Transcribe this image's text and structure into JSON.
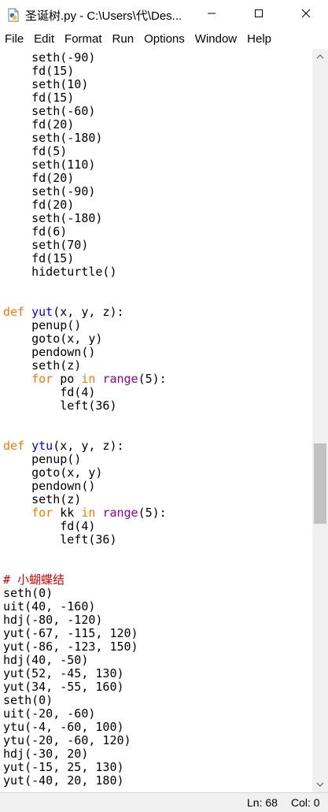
{
  "window": {
    "title": "圣诞树.py - C:\\Users\\代\\Des...",
    "icons": {
      "app": "python-file-icon",
      "minimize": "minimize-icon",
      "maximize": "maximize-icon",
      "close": "close-icon"
    }
  },
  "menu": [
    "File",
    "Edit",
    "Format",
    "Run",
    "Options",
    "Window",
    "Help"
  ],
  "editor": {
    "lines": [
      "    seth(-90)",
      "    fd(15)",
      "    seth(10)",
      "    fd(15)",
      "    seth(-60)",
      "    fd(20)",
      "    seth(-180)",
      "    fd(5)",
      "    seth(110)",
      "    fd(20)",
      "    seth(-90)",
      "    fd(20)",
      "    seth(-180)",
      "    fd(6)",
      "    seth(70)",
      "    fd(15)",
      "    hideturtle()",
      "",
      "",
      "def yut(x, y, z):",
      "    penup()",
      "    goto(x, y)",
      "    pendown()",
      "    seth(z)",
      "    for po in range(5):",
      "        fd(4)",
      "        left(36)",
      "",
      "",
      "def ytu(x, y, z):",
      "    penup()",
      "    goto(x, y)",
      "    pendown()",
      "    seth(z)",
      "    for kk in range(5):",
      "        fd(4)",
      "        left(36)",
      "",
      "",
      "# 小蝴蝶结",
      "seth(0)",
      "uit(40, -160)",
      "hdj(-80, -120)",
      "yut(-67, -115, 120)",
      "yut(-86, -123, 150)",
      "hdj(40, -50)",
      "yut(52, -45, 130)",
      "yut(34, -55, 160)",
      "seth(0)",
      "uit(-20, -60)",
      "ytu(-4, -60, 100)",
      "ytu(-20, -60, 120)",
      "hdj(-30, 20)",
      "yut(-15, 25, 130)",
      "yut(-40, 20, 180)"
    ],
    "colors": {
      "keyword": "#ff7700",
      "builtin": "#900090",
      "definition": "#0000ff",
      "comment": "#dd0000"
    }
  },
  "scrollbar": {
    "position": 0.6,
    "icons": {
      "up": "chevron-up-icon",
      "down": "chevron-down-icon"
    }
  },
  "status": {
    "line": "Ln: 68",
    "col": "Col: 0"
  }
}
